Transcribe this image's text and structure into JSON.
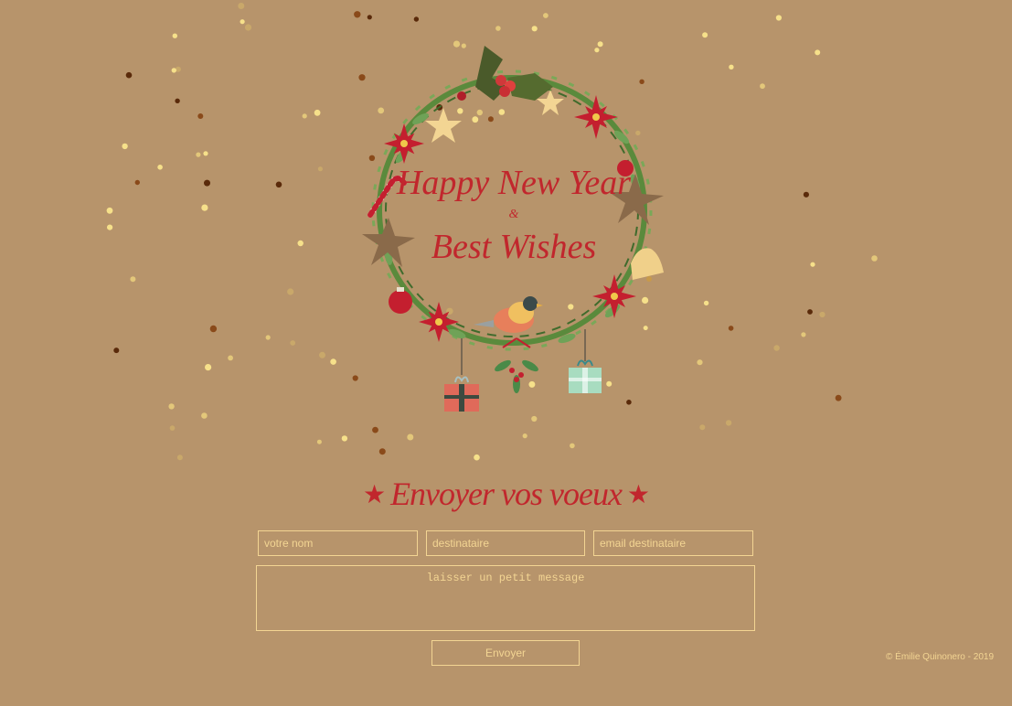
{
  "card": {
    "greeting_line1": "Happy New Year",
    "greeting_ampersand": "&",
    "greeting_line2": "Best Wishes"
  },
  "form": {
    "title": "Envoyer vos voeux",
    "name_placeholder": "votre nom",
    "recipient_placeholder": "destinataire",
    "email_placeholder": "email destinataire",
    "message_placeholder": "laisser un petit message",
    "send_label": "Envoyer"
  },
  "footer": {
    "copyright": "© Émilie Quinonero - 2019"
  },
  "colors": {
    "background": "#b7946b",
    "accent_red": "#c1272d",
    "field_gold": "#f3d593"
  }
}
